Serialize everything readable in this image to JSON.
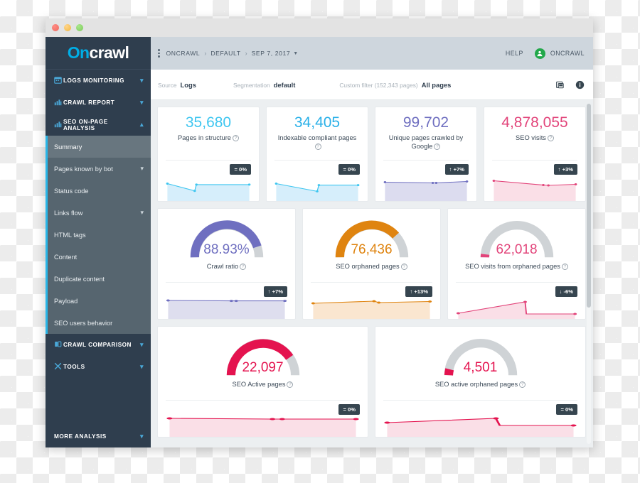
{
  "window": {
    "traffic_lights": [
      "close",
      "minimize",
      "maximize"
    ]
  },
  "sidebar": {
    "logo_prefix": "On",
    "logo_suffix": "crawl",
    "groups": [
      {
        "label": "LOGS MONITORING",
        "icon": "calendar-icon",
        "chevron": "down"
      },
      {
        "label": "CRAWL REPORT",
        "icon": "bar-chart-icon",
        "chevron": "down"
      },
      {
        "label": "SEO ON-PAGE ANALYSIS",
        "icon": "bar-chart-icon",
        "chevron": "up"
      }
    ],
    "submenu": [
      {
        "label": "Summary",
        "active": true,
        "chevron": ""
      },
      {
        "label": "Pages known by bot",
        "active": false,
        "chevron": "down"
      },
      {
        "label": "Status code",
        "active": false,
        "chevron": ""
      },
      {
        "label": "Links flow",
        "active": false,
        "chevron": "down"
      },
      {
        "label": "HTML tags",
        "active": false,
        "chevron": ""
      },
      {
        "label": "Content",
        "active": false,
        "chevron": ""
      },
      {
        "label": "Duplicate content",
        "active": false,
        "chevron": ""
      },
      {
        "label": "Payload",
        "active": false,
        "chevron": ""
      },
      {
        "label": "SEO users behavior",
        "active": false,
        "chevron": ""
      }
    ],
    "groups_bottom": [
      {
        "label": "CRAWL COMPARISON",
        "icon": "compare-icon",
        "chevron": "down"
      },
      {
        "label": "TOOLS",
        "icon": "tools-icon",
        "chevron": "down"
      }
    ],
    "more_analysis": {
      "label": "MORE ANALYSIS",
      "chevron": "down"
    }
  },
  "topbar": {
    "kebab": "kebab-menu-icon",
    "breadcrumb": [
      "ONCRAWL",
      "DEFAULT",
      "SEP 7, 2017"
    ],
    "separator": "›",
    "help_label": "HELP",
    "user_name": "ONCRAWL",
    "avatar_icon": "user-avatar-icon"
  },
  "filterbar": {
    "source_key": "Source",
    "source_value": "Logs",
    "segmentation_key": "Segmentation",
    "segmentation_value": "default",
    "custom_filter_key": "Custom filter (152,343 pages)",
    "custom_filter_value": "All pages",
    "pdf_icon": "pdf-export-icon",
    "info_icon": "info-icon"
  },
  "colors": {
    "cyan": "#3ec6f0",
    "blue": "#29b0e8",
    "purple": "#6f6fc0",
    "pink": "#e2447a",
    "crimson": "#e4134f",
    "orange": "#df8410",
    "gauge_track": "#cfd3d6",
    "badge_bg": "#36454f",
    "sidebar_bg": "#2f3e4e",
    "accent": "#29b6e8"
  },
  "chart_data": [
    {
      "type": "area",
      "id": "pages-in-structure",
      "title": "Pages in structure",
      "value": "35,680",
      "value_color": "#3ec6f0",
      "delta": "= 0%",
      "delta_dir": "flat",
      "x": [
        0,
        1,
        2,
        3
      ],
      "values": [
        0.72,
        0.42,
        0.68,
        0.68
      ],
      "ylim": [
        0,
        1
      ]
    },
    {
      "type": "area",
      "id": "indexable-compliant-pages",
      "title": "Indexable compliant pages",
      "value": "34,405",
      "value_color": "#29b0e8",
      "delta": "= 0%",
      "delta_dir": "flat",
      "x": [
        0,
        1,
        2,
        3
      ],
      "values": [
        0.72,
        0.4,
        0.66,
        0.66
      ],
      "ylim": [
        0,
        1
      ]
    },
    {
      "type": "area",
      "id": "unique-pages-crawled-by-google",
      "title": "Unique pages crawled by Google",
      "value": "99,702",
      "value_color": "#6f6fc0",
      "delta": "↑ +7%",
      "delta_dir": "up",
      "x": [
        0,
        1,
        2,
        3
      ],
      "values": [
        0.8,
        0.78,
        0.79,
        0.82
      ],
      "ylim": [
        0,
        1
      ]
    },
    {
      "type": "area",
      "id": "seo-visits",
      "title": "SEO visits",
      "value": "4,878,055",
      "value_color": "#e2447a",
      "delta": "↑ +3%",
      "delta_dir": "up",
      "x": [
        0,
        1,
        2,
        3
      ],
      "values": [
        0.86,
        0.7,
        0.68,
        0.7
      ],
      "ylim": [
        0,
        1
      ]
    },
    {
      "type": "gauge",
      "id": "crawl-ratio",
      "title": "Crawl ratio",
      "value": "88.93%",
      "value_color": "#6f6fc0",
      "gauge_fill_pct": 89,
      "gauge_color": "#6f6fc0",
      "delta": "↑ +7%",
      "delta_dir": "up",
      "spark_values": [
        0.8,
        0.8,
        0.8,
        0.8
      ],
      "spark_color": "#6f6fc0"
    },
    {
      "type": "gauge",
      "id": "seo-orphaned-pages",
      "title": "SEO orphaned pages",
      "value": "76,436",
      "value_color": "#df8410",
      "gauge_fill_pct": 77,
      "gauge_color": "#df8410",
      "delta": "↑ +13%",
      "delta_dir": "up",
      "spark_values": [
        0.7,
        0.78,
        0.72,
        0.76
      ],
      "spark_color": "#df8410"
    },
    {
      "type": "gauge",
      "id": "seo-visits-from-orphaned-pages",
      "title": "SEO visits from orphaned pages",
      "value": "62,018",
      "value_color": "#e2447a",
      "gauge_fill_pct": 3,
      "gauge_color": "#e2447a",
      "delta": "↓ -6%",
      "delta_dir": "down",
      "spark_values": [
        0.12,
        0.62,
        0.08,
        0.08
      ],
      "spark_color": "#e2447a"
    },
    {
      "type": "gauge",
      "id": "seo-active-pages",
      "title": "SEO Active pages",
      "value": "22,097",
      "value_color": "#e4134f",
      "gauge_fill_pct": 72,
      "gauge_color": "#e4134f",
      "delta": "= 0%",
      "delta_dir": "flat",
      "spark_values": [
        0.78,
        0.76,
        0.76,
        0.76
      ],
      "spark_color": "#e4134f"
    },
    {
      "type": "gauge",
      "id": "seo-active-orphaned-pages",
      "title": "SEO active orphaned pages",
      "value": "4,501",
      "value_color": "#e4134f",
      "gauge_fill_pct": 6,
      "gauge_color": "#e4134f",
      "delta": "= 0%",
      "delta_dir": "flat",
      "spark_values": [
        0.62,
        0.8,
        0.3,
        0.3
      ],
      "spark_color": "#e4134f"
    }
  ]
}
